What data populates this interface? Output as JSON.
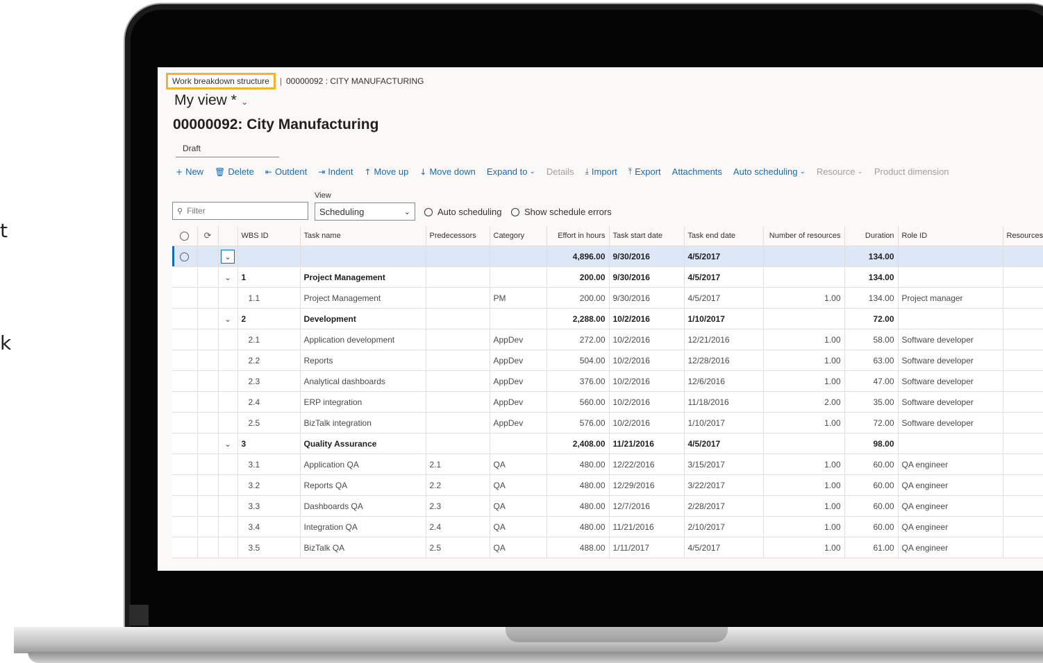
{
  "side_glyphs": [
    "t",
    "k"
  ],
  "breadcrumb": {
    "first": "Work breakdown structure",
    "separator": "|",
    "second": "00000092 : CITY MANUFACTURING"
  },
  "view": {
    "title": "My view *",
    "chevron": "⌄"
  },
  "record_title": "00000092: City Manufacturing",
  "status": "Draft",
  "toolbar": {
    "new": "New",
    "delete": "Delete",
    "outdent": "Outdent",
    "indent": "Indent",
    "move_up": "Move up",
    "move_down": "Move down",
    "expand_to": "Expand to",
    "details": "Details",
    "import": "Import",
    "export": "Export",
    "attachments": "Attachments",
    "auto_scheduling": "Auto scheduling",
    "resource": "Resource",
    "product_dimension": "Product dimension"
  },
  "filter": {
    "placeholder": "Filter"
  },
  "view_selector": {
    "label": "View",
    "value": "Scheduling"
  },
  "options": {
    "auto_scheduling": "Auto scheduling",
    "show_schedule_errors": "Show schedule errors"
  },
  "columns": [
    "WBS ID",
    "Task name",
    "Predecessors",
    "Category",
    "Effort in hours",
    "Task start date",
    "Task end date",
    "Number of resources",
    "Duration",
    "Role ID",
    "Resources"
  ],
  "rows": [
    {
      "wbs": "",
      "task": "",
      "pred": "",
      "cat": "",
      "effort": "4,896.00",
      "start": "9/30/2016",
      "end": "4/5/2017",
      "num": "",
      "dur": "134.00",
      "role": ""
    },
    {
      "wbs": "1",
      "task": "Project Management",
      "pred": "",
      "cat": "",
      "effort": "200.00",
      "start": "9/30/2016",
      "end": "4/5/2017",
      "num": "",
      "dur": "134.00",
      "role": ""
    },
    {
      "wbs": "1.1",
      "task": "Project Management",
      "pred": "",
      "cat": "PM",
      "effort": "200.00",
      "start": "9/30/2016",
      "end": "4/5/2017",
      "num": "1.00",
      "dur": "134.00",
      "role": "Project manager"
    },
    {
      "wbs": "2",
      "task": "Development",
      "pred": "",
      "cat": "",
      "effort": "2,288.00",
      "start": "10/2/2016",
      "end": "1/10/2017",
      "num": "",
      "dur": "72.00",
      "role": ""
    },
    {
      "wbs": "2.1",
      "task": "Application development",
      "pred": "",
      "cat": "AppDev",
      "effort": "272.00",
      "start": "10/2/2016",
      "end": "12/21/2016",
      "num": "1.00",
      "dur": "58.00",
      "role": "Software developer"
    },
    {
      "wbs": "2.2",
      "task": "Reports",
      "pred": "",
      "cat": "AppDev",
      "effort": "504.00",
      "start": "10/2/2016",
      "end": "12/28/2016",
      "num": "1.00",
      "dur": "63.00",
      "role": "Software developer"
    },
    {
      "wbs": "2.3",
      "task": "Analytical dashboards",
      "pred": "",
      "cat": "AppDev",
      "effort": "376.00",
      "start": "10/2/2016",
      "end": "12/6/2016",
      "num": "1.00",
      "dur": "47.00",
      "role": "Software developer"
    },
    {
      "wbs": "2.4",
      "task": "ERP integration",
      "pred": "",
      "cat": "AppDev",
      "effort": "560.00",
      "start": "10/2/2016",
      "end": "11/18/2016",
      "num": "2.00",
      "dur": "35.00",
      "role": "Software developer"
    },
    {
      "wbs": "2.5",
      "task": "BizTalk integration",
      "pred": "",
      "cat": "AppDev",
      "effort": "576.00",
      "start": "10/2/2016",
      "end": "1/10/2017",
      "num": "1.00",
      "dur": "72.00",
      "role": "Software developer"
    },
    {
      "wbs": "3",
      "task": "Quality Assurance",
      "pred": "",
      "cat": "",
      "effort": "2,408.00",
      "start": "11/21/2016",
      "end": "4/5/2017",
      "num": "",
      "dur": "98.00",
      "role": ""
    },
    {
      "wbs": "3.1",
      "task": "Application QA",
      "pred": "2.1",
      "cat": "QA",
      "effort": "480.00",
      "start": "12/22/2016",
      "end": "3/15/2017",
      "num": "1.00",
      "dur": "60.00",
      "role": "QA engineer"
    },
    {
      "wbs": "3.2",
      "task": "Reports QA",
      "pred": "2.2",
      "cat": "QA",
      "effort": "480.00",
      "start": "12/29/2016",
      "end": "3/22/2017",
      "num": "1.00",
      "dur": "60.00",
      "role": "QA engineer"
    },
    {
      "wbs": "3.3",
      "task": "Dashboards QA",
      "pred": "2.3",
      "cat": "QA",
      "effort": "480.00",
      "start": "12/7/2016",
      "end": "2/28/2017",
      "num": "1.00",
      "dur": "60.00",
      "role": "QA engineer"
    },
    {
      "wbs": "3.4",
      "task": "Integration QA",
      "pred": "2.4",
      "cat": "QA",
      "effort": "480.00",
      "start": "11/21/2016",
      "end": "2/10/2017",
      "num": "1.00",
      "dur": "60.00",
      "role": "QA engineer"
    },
    {
      "wbs": "3.5",
      "task": "BizTalk QA",
      "pred": "2.5",
      "cat": "QA",
      "effort": "488.00",
      "start": "1/11/2017",
      "end": "4/5/2017",
      "num": "1.00",
      "dur": "61.00",
      "role": "QA engineer"
    }
  ],
  "colors": {
    "accent": "#0f6cbd",
    "highlight_border": "#f0b429",
    "selected_row": "#dce7f7"
  }
}
